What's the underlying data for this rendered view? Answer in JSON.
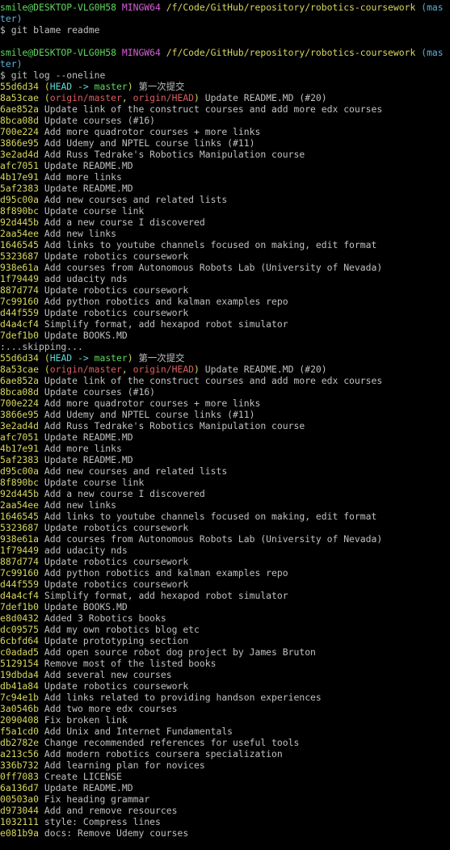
{
  "colors": {
    "background": "#000000",
    "text": "#c0c0c0",
    "prompt_user": "#5fd75f",
    "prompt_mingw": "#d75fd7",
    "prompt_path": "#d7d75f",
    "prompt_branch": "#5fafd7",
    "hash": "#d7d75f",
    "head": "#5fd7d7",
    "local_branch": "#5fd75f",
    "remote_ref": "#d75f5f"
  },
  "prompt": {
    "user_host": "smile@DESKTOP-VLG0H58",
    "shell": "MINGW64",
    "path": "/f/Code/GitHub/repository/robotics-coursework",
    "branch_part1": "(mas",
    "branch_part2": "ter)",
    "symbol": "$"
  },
  "commands": {
    "first": "git blame readme",
    "second": "git log --oneline"
  },
  "skip_text": ":...skipping...",
  "decorations": {
    "head_label": "HEAD",
    "arrow": "->",
    "master": "master",
    "origin_master": "origin/master",
    "origin_head": "origin/HEAD"
  },
  "log_first": [
    {
      "hash": "55d6d34",
      "deco": "head",
      "msg": "第一次提交"
    },
    {
      "hash": "8a53cae",
      "deco": "origin",
      "msg": "Update README.MD (#20)"
    },
    {
      "hash": "6ae852a",
      "msg": "Update link of the construct courses and add more edx courses"
    },
    {
      "hash": "8bca08d",
      "msg": "Update courses (#16)"
    },
    {
      "hash": "700e224",
      "msg": "Add more quadrotor courses + more links"
    },
    {
      "hash": "3866e95",
      "msg": "Add Udemy and NPTEL course links (#11)"
    },
    {
      "hash": "3e2ad4d",
      "msg": "Add Russ Tedrake's Robotics Manipulation course"
    },
    {
      "hash": "afc7051",
      "msg": "Update README.MD"
    },
    {
      "hash": "4b17e91",
      "msg": "Add more links"
    },
    {
      "hash": "5af2383",
      "msg": "Update README.MD"
    },
    {
      "hash": "d95c00a",
      "msg": "Add new courses and related lists"
    },
    {
      "hash": "8f890bc",
      "msg": "Update course link"
    },
    {
      "hash": "92d445b",
      "msg": "Add a new course I discovered"
    },
    {
      "hash": "2aa54ee",
      "msg": "Add new links"
    },
    {
      "hash": "1646545",
      "msg": "Add links to youtube channels focused on making, edit format"
    },
    {
      "hash": "5323687",
      "msg": "Update robotics coursework"
    },
    {
      "hash": "938e61a",
      "msg": "Add courses from Autonomous Robots Lab (University of Nevada)"
    },
    {
      "hash": "1f79449",
      "msg": "add udacity nds"
    },
    {
      "hash": "887d774",
      "msg": "Update robotics coursework"
    },
    {
      "hash": "7c99160",
      "msg": "Add python robotics and kalman examples repo"
    },
    {
      "hash": "d44f559",
      "msg": "Update robotics coursework"
    },
    {
      "hash": "d4a4cf4",
      "msg": "Simplify format, add hexapod robot simulator"
    },
    {
      "hash": "7def1b0",
      "msg": "Update BOOKS.MD"
    }
  ],
  "log_second": [
    {
      "hash": "55d6d34",
      "deco": "head",
      "msg": "第一次提交"
    },
    {
      "hash": "8a53cae",
      "deco": "origin",
      "msg": "Update README.MD (#20)"
    },
    {
      "hash": "6ae852a",
      "msg": "Update link of the construct courses and add more edx courses"
    },
    {
      "hash": "8bca08d",
      "msg": "Update courses (#16)"
    },
    {
      "hash": "700e224",
      "msg": "Add more quadrotor courses + more links"
    },
    {
      "hash": "3866e95",
      "msg": "Add Udemy and NPTEL course links (#11)"
    },
    {
      "hash": "3e2ad4d",
      "msg": "Add Russ Tedrake's Robotics Manipulation course"
    },
    {
      "hash": "afc7051",
      "msg": "Update README.MD"
    },
    {
      "hash": "4b17e91",
      "msg": "Add more links"
    },
    {
      "hash": "5af2383",
      "msg": "Update README.MD"
    },
    {
      "hash": "d95c00a",
      "msg": "Add new courses and related lists"
    },
    {
      "hash": "8f890bc",
      "msg": "Update course link"
    },
    {
      "hash": "92d445b",
      "msg": "Add a new course I discovered"
    },
    {
      "hash": "2aa54ee",
      "msg": "Add new links"
    },
    {
      "hash": "1646545",
      "msg": "Add links to youtube channels focused on making, edit format"
    },
    {
      "hash": "5323687",
      "msg": "Update robotics coursework"
    },
    {
      "hash": "938e61a",
      "msg": "Add courses from Autonomous Robots Lab (University of Nevada)"
    },
    {
      "hash": "1f79449",
      "msg": "add udacity nds"
    },
    {
      "hash": "887d774",
      "msg": "Update robotics coursework"
    },
    {
      "hash": "7c99160",
      "msg": "Add python robotics and kalman examples repo"
    },
    {
      "hash": "d44f559",
      "msg": "Update robotics coursework"
    },
    {
      "hash": "d4a4cf4",
      "msg": "Simplify format, add hexapod robot simulator"
    },
    {
      "hash": "7def1b0",
      "msg": "Update BOOKS.MD"
    },
    {
      "hash": "e8d0432",
      "msg": "Added 3 Robotics books"
    },
    {
      "hash": "dc09575",
      "msg": "Add my own robotics blog etc"
    },
    {
      "hash": "6cbfd64",
      "msg": "Update prototyping section"
    },
    {
      "hash": "c0adad5",
      "msg": "Add open source robot dog project by James Bruton"
    },
    {
      "hash": "5129154",
      "msg": "Remove most of the listed books"
    },
    {
      "hash": "19dbda4",
      "msg": "Add several new courses"
    },
    {
      "hash": "db41a84",
      "msg": "Update robotics coursework"
    },
    {
      "hash": "7c94e1b",
      "msg": "Add links related to providing handson experiences"
    },
    {
      "hash": "3a0546b",
      "msg": "Add two more edx courses"
    },
    {
      "hash": "2090408",
      "msg": "Fix broken link"
    },
    {
      "hash": "f5a1cd0",
      "msg": "Add Unix and Internet Fundamentals"
    },
    {
      "hash": "db2782e",
      "msg": "Change recommended references for useful tools"
    },
    {
      "hash": "a213c56",
      "msg": "Add modern robotics coursera specialization"
    },
    {
      "hash": "336b732",
      "msg": "Add learning plan for novices"
    },
    {
      "hash": "0ff7083",
      "msg": "Create LICENSE"
    },
    {
      "hash": "6a136d7",
      "msg": "Update README.MD"
    },
    {
      "hash": "00503a0",
      "msg": "Fix heading grammar"
    },
    {
      "hash": "d973044",
      "msg": "Add and remove resources"
    },
    {
      "hash": "1032111",
      "msg": "style: Compress lines"
    },
    {
      "hash": "e081b9a",
      "msg": "docs: Remove Udemy courses"
    }
  ]
}
